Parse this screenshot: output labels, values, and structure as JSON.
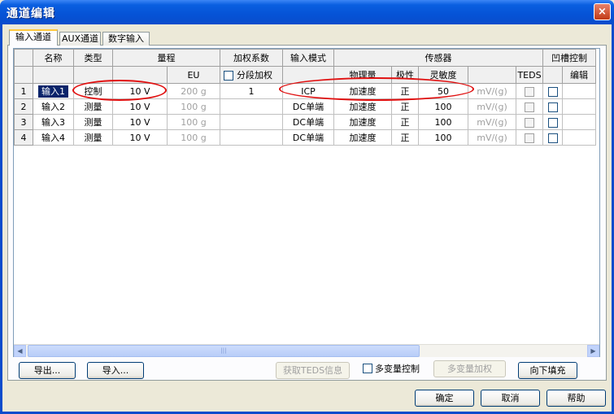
{
  "window": {
    "title": "通道编辑",
    "close_symbol": "×"
  },
  "tabs": [
    {
      "label": "输入通道",
      "active": true
    },
    {
      "label": "AUX通道",
      "active": false
    },
    {
      "label": "数字输入",
      "active": false
    }
  ],
  "grid": {
    "header1": {
      "name": "名称",
      "type": "类型",
      "range": "量程",
      "weight": "加权系数",
      "input_mode": "输入模式",
      "sensor": "传感器",
      "notch": "凹槽控制"
    },
    "header2": {
      "eu": "EU",
      "segment_weight": "分段加权",
      "physical": "物理量",
      "polarity": "极性",
      "sensitivity": "灵敏度",
      "teds": "TEDS",
      "edit": "编辑"
    },
    "rows": [
      {
        "num": "1",
        "name": "输入1",
        "type": "控制",
        "range": "10 V",
        "eu": "200 g",
        "weight": "1",
        "mode": "ICP",
        "physical": "加速度",
        "polarity": "正",
        "sensitivity": "50",
        "unit": "mV/(g)"
      },
      {
        "num": "2",
        "name": "输入2",
        "type": "测量",
        "range": "10 V",
        "eu": "100 g",
        "weight": "",
        "mode": "DC单端",
        "physical": "加速度",
        "polarity": "正",
        "sensitivity": "100",
        "unit": "mV/(g)"
      },
      {
        "num": "3",
        "name": "输入3",
        "type": "测量",
        "range": "10 V",
        "eu": "100 g",
        "weight": "",
        "mode": "DC单端",
        "physical": "加速度",
        "polarity": "正",
        "sensitivity": "100",
        "unit": "mV/(g)"
      },
      {
        "num": "4",
        "name": "输入4",
        "type": "测量",
        "range": "10 V",
        "eu": "100 g",
        "weight": "",
        "mode": "DC单端",
        "physical": "加速度",
        "polarity": "正",
        "sensitivity": "100",
        "unit": "mV/(g)"
      }
    ]
  },
  "scrollbar": {
    "left_arrow": "◀",
    "right_arrow": "▶",
    "grip": "|||"
  },
  "buttons": {
    "export": "导出...",
    "import": "导入...",
    "teds_info": "获取TEDS信息",
    "multi_var_control": "多变量控制",
    "multi_var_weight": "多变量加权",
    "fill_down": "向下填充",
    "ok": "确定",
    "cancel": "取消",
    "help": "帮助"
  },
  "colors": {
    "title_bar": "#0553d6",
    "annotation": "#e01010",
    "selection": "#0a246a"
  }
}
